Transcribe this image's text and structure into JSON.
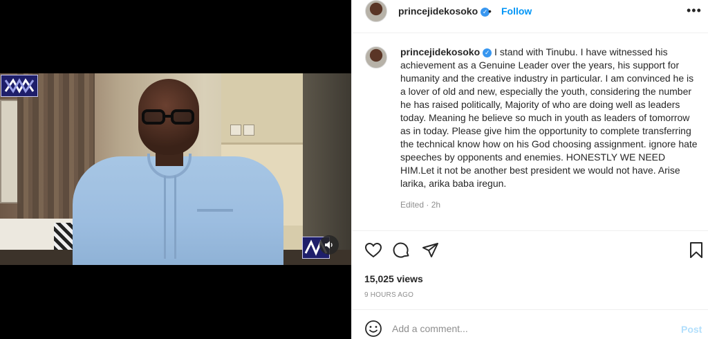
{
  "post_header": {
    "username": "princejidekosoko",
    "separator": "•",
    "follow_label": "Follow",
    "more_icon": "more-horizontal-icon"
  },
  "caption": {
    "username": "princejidekosoko",
    "text": "I stand with Tinubu. I have witnessed his achievement as a Genuine Leader over the years, his support for humanity and the creative industry in particular. I am convinced he is a lover of old and new, especially the youth, considering the number he has raised politically, Majority of who are doing well as leaders today. Meaning he believe so much in youth as leaders of tomorrow as in today. Please give him the opportunity to complete transferring the technical know how on his God choosing assignment. ignore hate speeches by opponents and enemies. HONESTLY WE NEED HIM.Let it not be another best president we would not have. Arise larika, arika baba iregun.",
    "edited": "Edited · 2h"
  },
  "actions": {
    "icons": [
      "heart-icon",
      "comment-icon",
      "share-icon",
      "bookmark-icon"
    ]
  },
  "stats": {
    "views": "15,025 views",
    "time_ago": "9 HOURS AGO"
  },
  "comment_box": {
    "placeholder": "Add a comment...",
    "post_label": "Post"
  },
  "media": {
    "type": "video",
    "sound_icon": "speaker-icon"
  },
  "colors": {
    "accent": "#0095f6",
    "verified": "#3897f0",
    "muted_text": "#8e8e8e",
    "post_disabled": "#b2dffc"
  }
}
